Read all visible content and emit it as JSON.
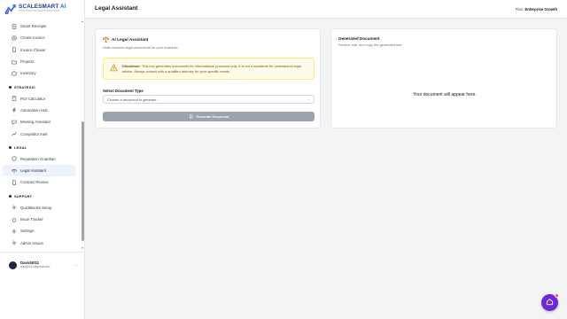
{
  "brand": {
    "name": "SCALESMART",
    "ai": "AI",
    "tagline": "INTELLIGENT BUSINESS SOLUTIONS",
    "primary_color": "#1e3a8a",
    "accent_color": "#2563eb"
  },
  "sidebar": {
    "items": [
      {
        "label": "Smart Receipts",
        "icon": "receipt-icon"
      },
      {
        "label": "Create Invoice",
        "icon": "plus-icon"
      },
      {
        "label": "Invoice Chaser",
        "icon": "document-icon"
      },
      {
        "label": "Projects",
        "icon": "folder-icon"
      },
      {
        "label": "Inventory",
        "icon": "box-icon"
      }
    ],
    "sections": [
      {
        "title": "STRATEGIC",
        "items": [
          {
            "label": "ROI Calculator",
            "icon": "calculator-icon"
          },
          {
            "label": "Automation Hub",
            "icon": "bolt-icon"
          },
          {
            "label": "Meeting Assistant",
            "icon": "chat-icon"
          },
          {
            "label": "Competitor Intel",
            "icon": "chart-icon"
          }
        ]
      },
      {
        "title": "LEGAL",
        "items": [
          {
            "label": "Reputation Guardian",
            "icon": "shield-icon"
          },
          {
            "label": "Legal Assistant",
            "icon": "scale-icon",
            "active": true
          },
          {
            "label": "Contract Review",
            "icon": "document-icon"
          }
        ]
      },
      {
        "title": "SUPPORT",
        "items": [
          {
            "label": "QuickBooks Setup",
            "icon": "gear-icon"
          },
          {
            "label": "Issue Tracker",
            "icon": "bug-icon"
          },
          {
            "label": "Settings",
            "icon": "gear-icon"
          },
          {
            "label": "Admin Issues",
            "icon": "gear-icon"
          }
        ]
      }
    ],
    "user": {
      "name": "David4011",
      "email": "david4011@gmail.com"
    }
  },
  "header": {
    "title": "Legal Assistant",
    "plan_label": "Plan:",
    "plan_value": "Enterprise Growth"
  },
  "left_card": {
    "title": "AI Legal Assistant",
    "subtitle": "Draft common legal documents for your business.",
    "disclaimer_label": "Disclaimer:",
    "disclaimer_text": "This tool generates documents for informational purposes only. It is not a substitute for professional legal advice. Always consult with a qualified attorney for your specific needs.",
    "field_label": "Select Document Type",
    "select_placeholder": "Choose a document to generate...",
    "button_label": "Generate Document"
  },
  "right_card": {
    "title": "Generated Document",
    "subtitle": "Review, edit, and copy the generated text.",
    "placeholder": "Your document will appear here."
  },
  "colors": {
    "warning_bg": "#fefce8",
    "warning_border": "#fde68a",
    "fab": "#6d28d9",
    "badge": "#ef4444"
  }
}
